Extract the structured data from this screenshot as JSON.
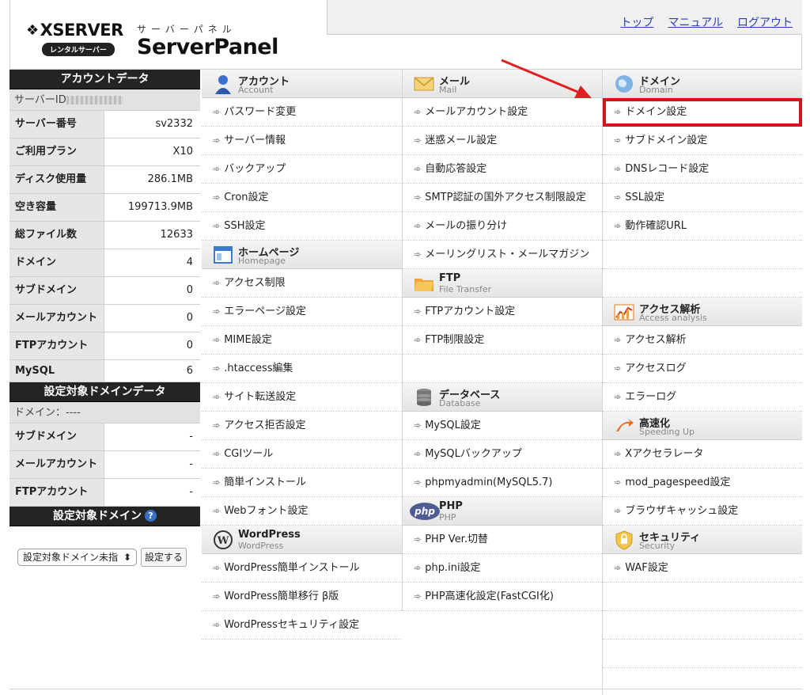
{
  "header": {
    "brand": "XSERVER",
    "rental_badge": "レンタルサーバー",
    "panel_kana": "サーバーパネル",
    "panel_name": "ServerPanel",
    "links": [
      "トップ",
      "マニュアル",
      "ログアウト"
    ]
  },
  "account_data": {
    "title": "アカウントデータ",
    "server_id_label": "サーバーID",
    "rows": [
      {
        "label": "サーバー番号",
        "value": "sv2332"
      },
      {
        "label": "ご利用プラン",
        "value": "X10"
      },
      {
        "label": "ディスク使用量",
        "value": "286.1MB"
      },
      {
        "label": "空き容量",
        "value": "199713.9MB"
      },
      {
        "label": "総ファイル数",
        "value": "12633"
      },
      {
        "label": "ドメイン",
        "value": "4"
      },
      {
        "label": "サブドメイン",
        "value": "0"
      },
      {
        "label": "メールアカウント",
        "value": "0"
      },
      {
        "label": "FTPアカウント",
        "value": "0"
      },
      {
        "label": "MySQL",
        "value": "6"
      }
    ]
  },
  "target_domain_data": {
    "title": "設定対象ドメインデータ",
    "domain_label": "ドメイン：----",
    "rows": [
      {
        "label": "サブドメイン",
        "value": "-"
      },
      {
        "label": "メールアカウント",
        "value": "-"
      },
      {
        "label": "FTPアカウント",
        "value": "-"
      }
    ]
  },
  "target_domain": {
    "title": "設定対象ドメイン",
    "help": "?",
    "select_value": "設定対象ドメイン未指",
    "button": "設定する"
  },
  "sections": {
    "account": {
      "ja": "アカウント",
      "en": "Account",
      "items": [
        "パスワード変更",
        "サーバー情報",
        "バックアップ",
        "Cron設定",
        "SSH設定"
      ]
    },
    "homepage": {
      "ja": "ホームページ",
      "en": "Homepage",
      "items": [
        "アクセス制限",
        "エラーページ設定",
        "MIME設定",
        ".htaccess編集",
        "サイト転送設定",
        "アクセス拒否設定",
        "CGIツール",
        "簡単インストール",
        "Webフォント設定"
      ]
    },
    "wordpress": {
      "ja": "WordPress",
      "en": "WordPress",
      "items": [
        "WordPress簡単インストール",
        "WordPress簡単移行 β版",
        "WordPressセキュリティ設定"
      ]
    },
    "mail": {
      "ja": "メール",
      "en": "Mail",
      "items": [
        "メールアカウント設定",
        "迷惑メール設定",
        "自動応答設定",
        "SMTP認証の国外アクセス制限設定",
        "メールの振り分け",
        "メーリングリスト・メールマガジン"
      ]
    },
    "ftp": {
      "ja": "FTP",
      "en": "File Transfer",
      "items": [
        "FTPアカウント設定",
        "FTP制限設定"
      ]
    },
    "database": {
      "ja": "データベース",
      "en": "Database",
      "items": [
        "MySQL設定",
        "MySQLバックアップ",
        "phpmyadmin(MySQL5.7)"
      ]
    },
    "php": {
      "ja": "PHP",
      "en": "PHP",
      "items": [
        "PHP Ver.切替",
        "php.ini設定",
        "PHP高速化設定(FastCGI化)"
      ]
    },
    "domain": {
      "ja": "ドメイン",
      "en": "Domain",
      "items": [
        "ドメイン設定",
        "サブドメイン設定",
        "DNSレコード設定",
        "SSL設定",
        "動作確認URL"
      ]
    },
    "access": {
      "ja": "アクセス解析",
      "en": "Access analysis",
      "items": [
        "アクセス解析",
        "アクセスログ",
        "エラーログ"
      ]
    },
    "speed": {
      "ja": "高速化",
      "en": "Speeding Up",
      "items": [
        "Xアクセラレータ",
        "mod_pagespeed設定",
        "ブラウザキャッシュ設定"
      ]
    },
    "security": {
      "ja": "セキュリティ",
      "en": "Security",
      "items": [
        "WAF設定"
      ]
    }
  },
  "colors": {
    "highlight": "#d4141c",
    "link": "#2a3fb4",
    "sidebar_head": "#242424"
  }
}
